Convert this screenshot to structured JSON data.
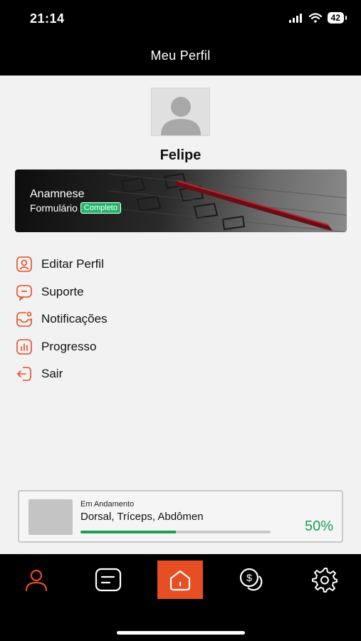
{
  "status_bar": {
    "time": "21:14",
    "battery": "42"
  },
  "header": {
    "title": "Meu Perfil"
  },
  "profile": {
    "name": "Felipe"
  },
  "anamnese": {
    "title": "Anamnese",
    "subtitle": "Formulário",
    "badge": "Completo"
  },
  "menu": {
    "items": [
      {
        "label": "Editar Perfil",
        "icon": "user-square-icon"
      },
      {
        "label": "Suporte",
        "icon": "chat-bubble-icon"
      },
      {
        "label": "Notificações",
        "icon": "notification-icon"
      },
      {
        "label": "Progresso",
        "icon": "bar-chart-icon"
      },
      {
        "label": "Sair",
        "icon": "logout-icon"
      }
    ]
  },
  "workout": {
    "status": "Em Andamento",
    "name": "Dorsal, Tríceps, Abdômen",
    "progress_label": "50%",
    "progress": 0.5
  },
  "tab_bar": {
    "items": [
      "profile-icon",
      "document-icon",
      "home-icon",
      "money-icon",
      "settings-icon"
    ],
    "active": "profile",
    "accent": "#e64e24"
  }
}
